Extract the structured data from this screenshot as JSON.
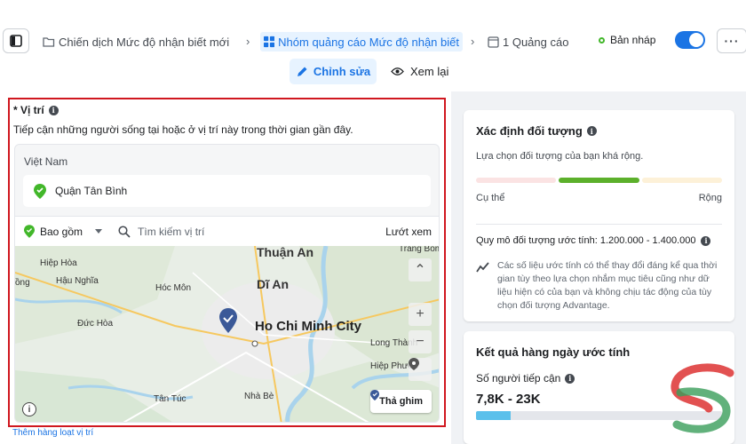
{
  "breadcrumbs": {
    "campaign": "Chiến dịch Mức độ nhận biết mới",
    "ad_set": "Nhóm quảng cáo Mức độ nhận biết",
    "ad": "1 Quảng cáo"
  },
  "status": {
    "label": "Bản nháp",
    "toggle_on": true
  },
  "tabs": {
    "edit": "Chỉnh sửa",
    "review": "Xem lại"
  },
  "location": {
    "title": "* Vị trí",
    "description": "Tiếp cận những người sống tại hoặc ở vị trí này trong thời gian gần đây.",
    "country": "Việt Nam",
    "selected": "Quận Tân Bình",
    "include_label": "Bao gồm",
    "search_placeholder": "Tìm kiếm vị trí",
    "browse_label": "Lướt xem",
    "drop_pin_label": "Thả ghim",
    "bulk_link": "Thêm hàng loạt vị trí"
  },
  "map_labels": {
    "hiep_hoa": "Hiệp Hòa",
    "go": "ồng",
    "hau_nghia": "Hậu Nghĩa",
    "hoc_mon": "Hóc Môn",
    "thuan_an": "Thuận An",
    "di_an": "Dĩ An",
    "trang_bom": "Trảng Bom",
    "duc_hoa": "Đức Hòa",
    "hcm": "Ho Chi Minh City",
    "long_thanh": "Long Thành",
    "hiep_phuoc": "Hiệp Phước",
    "tan_tuc": "Tân Túc",
    "nha_be": "Nhà Bè"
  },
  "audience": {
    "title": "Xác định đối tượng",
    "subtitle": "Lựa chọn đối tượng của bạn khá rộng.",
    "specific_label": "Cụ thể",
    "broad_label": "Rộng",
    "size_text": "Quy mô đối tượng ước tính: 1.200.000 - 1.400.000",
    "note": "Các số liệu ước tính có thể thay đổi đáng kể qua thời gian tùy theo lựa chọn nhắm mục tiêu cũng như dữ liệu hiện có của bạn và không chịu tác động của tùy chọn đối tượng Advantage."
  },
  "daily_results": {
    "title": "Kết quả hàng ngày ước tính",
    "reach_label": "Số người tiếp cận",
    "reach_value": "7,8K - 23K",
    "reach_fill_percent": 14
  },
  "colors": {
    "accent": "#1b74e4",
    "highlight_border": "#d0171f",
    "meter_low": "#fbe3e3",
    "meter_mid": "#5cb02b",
    "meter_high": "#fdf1d8",
    "pin_green": "#42b72a"
  }
}
